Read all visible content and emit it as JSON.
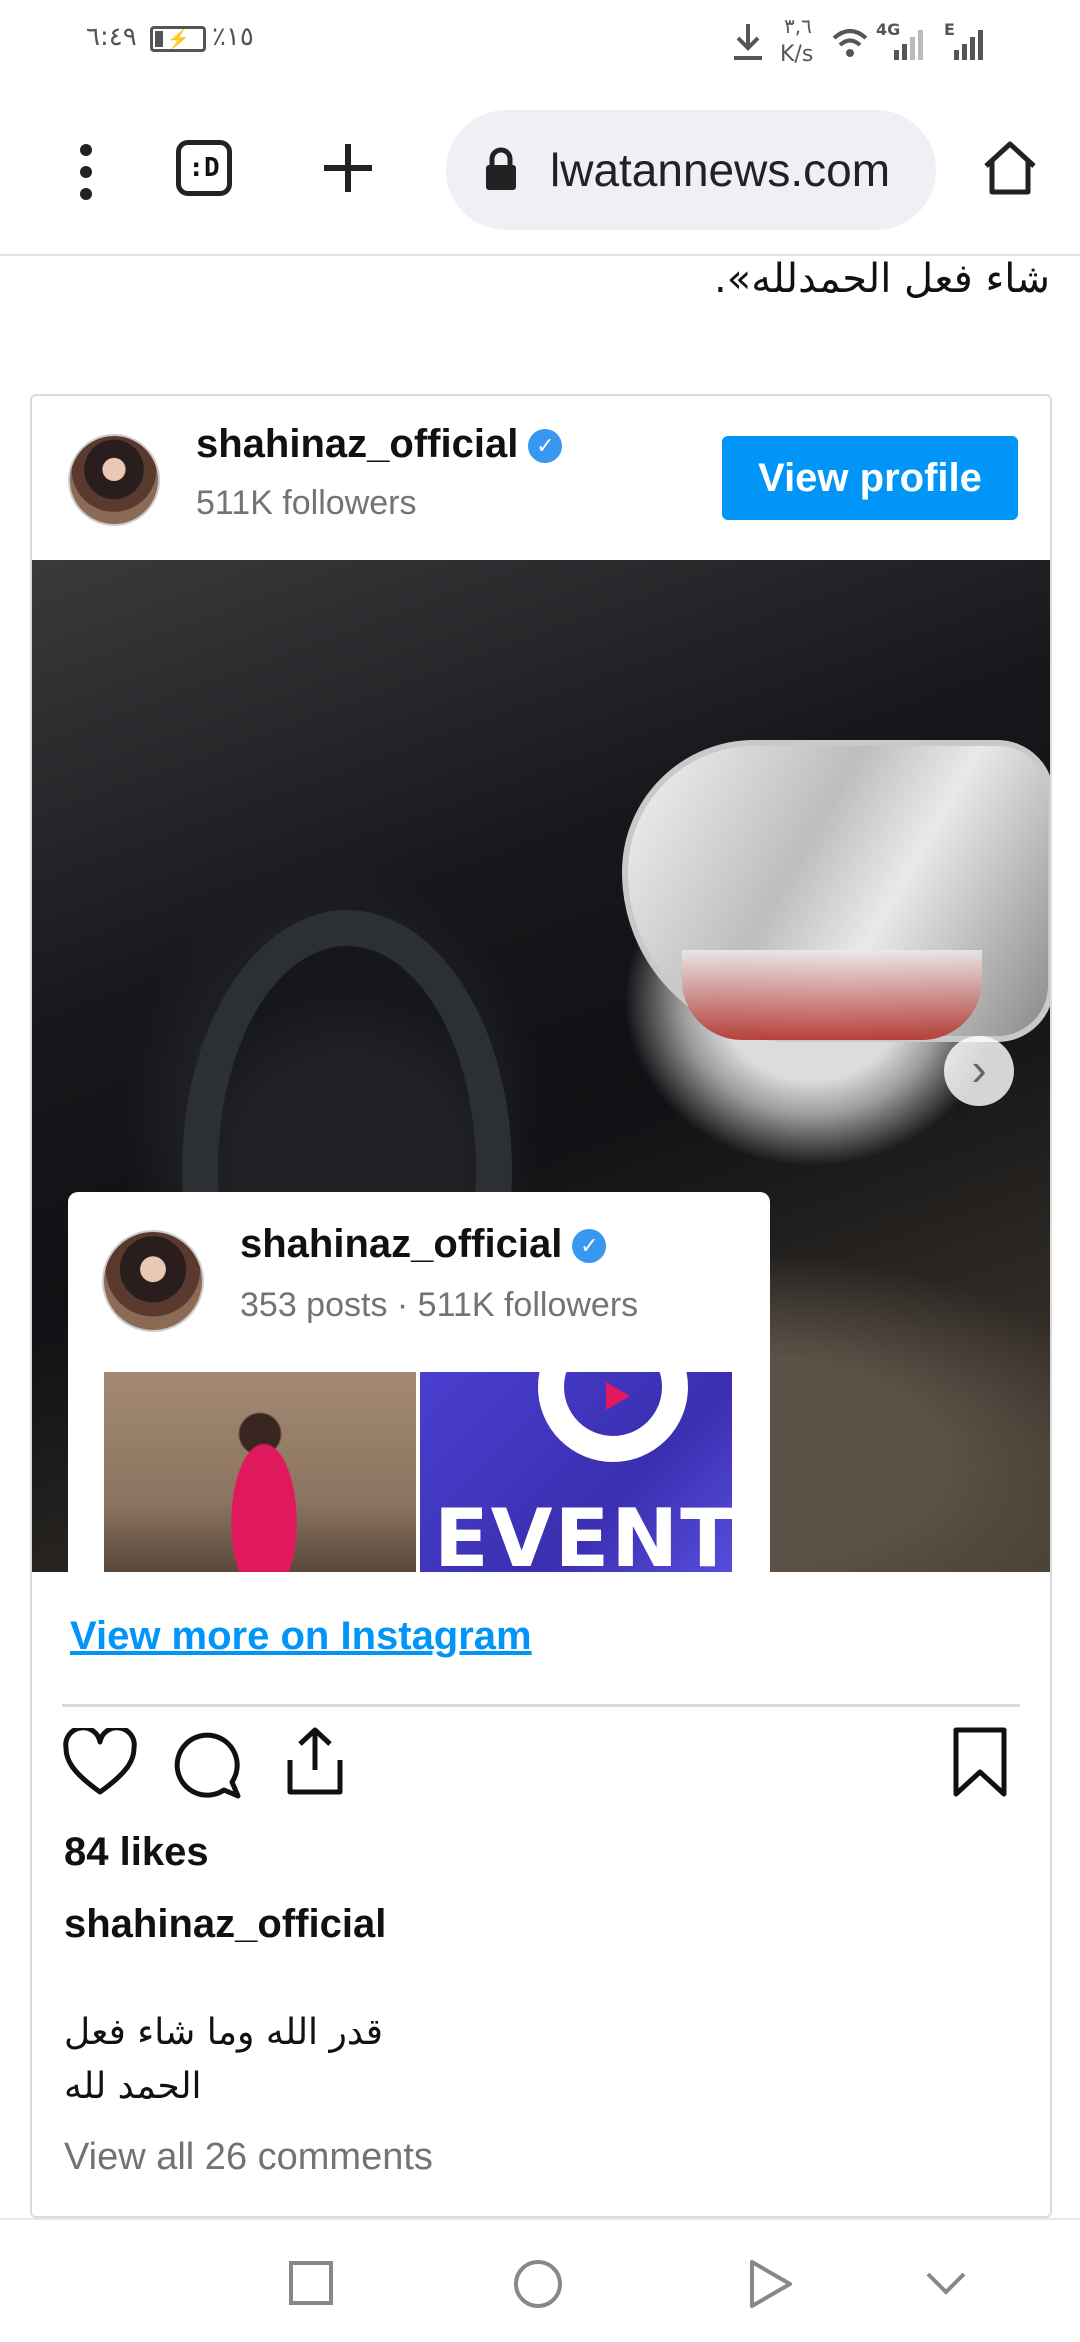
{
  "status_bar": {
    "time": "٦:٤٩",
    "battery_percent": "٪١٥",
    "net_speed_value": "٣,٦",
    "net_speed_unit": "K/s",
    "network_label_1": "4G",
    "network_label_2": "E"
  },
  "browser": {
    "url": "lwatannews.com",
    "tab_count_label": ":D",
    "icons": [
      "more-vert-icon",
      "tabs-icon",
      "plus-icon",
      "lock-icon",
      "home-icon"
    ]
  },
  "article": {
    "text_line": "شاء فعل الحمدلله»."
  },
  "instagram_embed": {
    "username": "shahinaz_official",
    "followers": "511K followers",
    "view_profile_label": "View profile",
    "overlay": {
      "username": "shahinaz_official",
      "stats": "353 posts · 511K followers",
      "thumb2_text": "EVENTS"
    },
    "view_more_label": "View more on Instagram",
    "likes": "84 likes",
    "caption_user": "shahinaz_official",
    "caption_line1": "قدر الله وما شاء فعل",
    "caption_line2": "الحمد لله",
    "view_comments_label": "View all 26 comments",
    "colors": {
      "accent": "#0095f6",
      "verified": "#3897f0",
      "subtle": "#737373"
    }
  },
  "nav_bar": {
    "icons": [
      "recents-square-icon",
      "home-circle-icon",
      "back-triangle-icon",
      "collapse-chevron-icon"
    ]
  }
}
